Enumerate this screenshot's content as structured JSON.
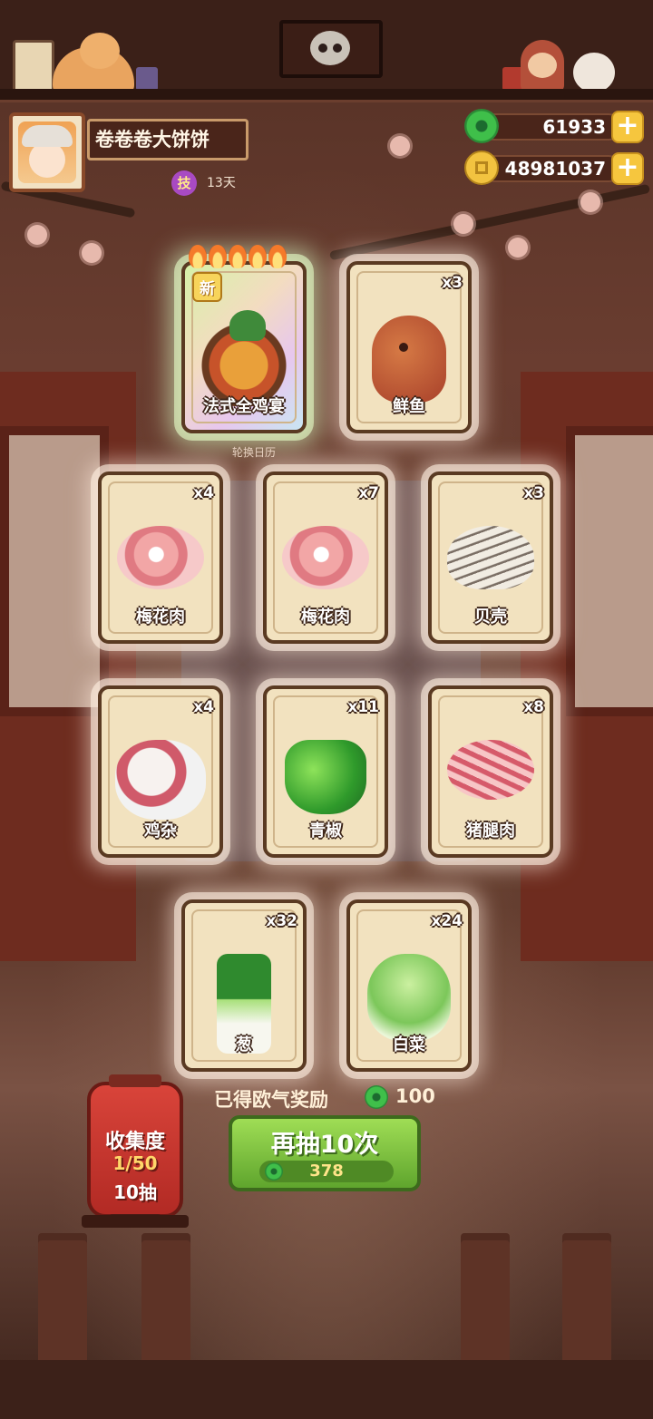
{
  "player": {
    "name": "卷卷卷大饼饼",
    "skill_badge": "技",
    "skill_days": "13天"
  },
  "currency": {
    "jade": "61933",
    "coins": "48981037"
  },
  "featured_card": {
    "new_badge": "新",
    "name": "法式全鸡宴",
    "flame_level": 5
  },
  "rotate_calendar": "轮换日历",
  "cards": [
    {
      "name": "鲜鱼",
      "count": "x3",
      "icon": "fish-icon"
    },
    {
      "name": "梅花肉",
      "count": "x4",
      "icon": "pork-icon"
    },
    {
      "name": "梅花肉",
      "count": "x7",
      "icon": "pork-icon"
    },
    {
      "name": "贝壳",
      "count": "x3",
      "icon": "shell-icon"
    },
    {
      "name": "鸡杂",
      "count": "x4",
      "icon": "giblets-icon"
    },
    {
      "name": "青椒",
      "count": "x11",
      "icon": "pepper-icon"
    },
    {
      "name": "猪腿肉",
      "count": "x8",
      "icon": "hock-icon"
    },
    {
      "name": "葱",
      "count": "x32",
      "icon": "scallion-icon"
    },
    {
      "name": "白菜",
      "count": "x24",
      "icon": "cabbage-icon"
    }
  ],
  "reward": {
    "label": "已得欧气奖励",
    "value": "100"
  },
  "collection": {
    "title": "收集度",
    "progress": "1/50",
    "draws": "10抽"
  },
  "draw_button": {
    "label": "再抽10次",
    "cost": "378"
  }
}
